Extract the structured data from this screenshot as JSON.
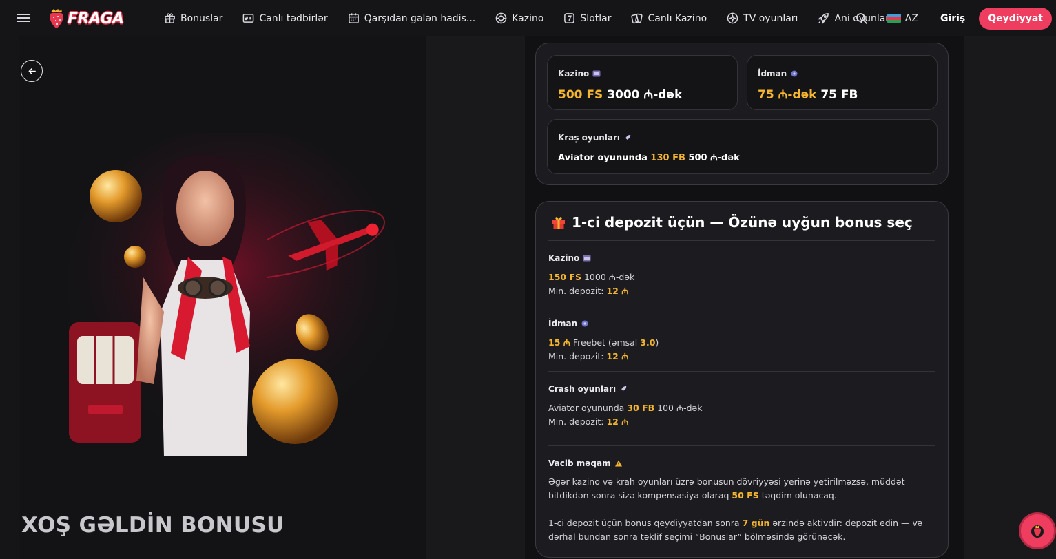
{
  "header": {
    "logo_text": "FRAGA",
    "nav": [
      {
        "label": "Bonuslar",
        "icon": "gift-icon"
      },
      {
        "label": "Canlı tədbirlər",
        "icon": "live-score-icon"
      },
      {
        "label": "Qarşıdan gələn hadis...",
        "icon": "calendar-icon"
      },
      {
        "label": "Kazino",
        "icon": "casino-chip-icon"
      },
      {
        "label": "Slotlar",
        "icon": "slot-seven-icon"
      },
      {
        "label": "Canlı Kazino",
        "icon": "cards-icon"
      },
      {
        "label": "TV oyunları",
        "icon": "tv-games-icon"
      },
      {
        "label": "Ani oyunlar",
        "icon": "rocket-icon"
      }
    ],
    "lang": "AZ",
    "login_label": "Giriş",
    "register_label": "Qeydiyyat"
  },
  "hero": {
    "title": "XOŞ GƏLDİN BONUSU"
  },
  "summary": {
    "kazino": {
      "label": "Kazino",
      "highlight": "500 FS",
      "rest": "3000 ₼-dək"
    },
    "idman": {
      "label": "İdman",
      "highlight": "75 ₼-dək",
      "rest": "75 FB"
    },
    "crash": {
      "label": "Kraş oyunları",
      "pre": "Aviator oyununda",
      "highlight": "130 FB",
      "rest": "500 ₼-dək"
    }
  },
  "deposit": {
    "title": "1-ci depozit üçün — Özünə uyğun bonus seç",
    "sections": {
      "kazino": {
        "label": "Kazino",
        "highlight": "150 FS",
        "rest": "1000 ₼-dək",
        "min_label": "Min. depozit:",
        "min_value": "12 ₼"
      },
      "idman": {
        "label": "İdman",
        "highlight": "15 ₼",
        "rest_a": "Freebet (əmsal",
        "coef": "3.0",
        "rest_b": ")",
        "min_label": "Min. depozit:",
        "min_value": "12 ₼"
      },
      "crash": {
        "label": "Crash oyunları",
        "pre": "Aviator oyununda",
        "highlight": "30 FB",
        "rest": "100 ₼-dək",
        "min_label": "Min. depozit:",
        "min_value": "12 ₼"
      }
    },
    "important": {
      "label": "Vacib məqam",
      "p1_a": "Əgər kazino və krah oyunları üzrə bonusun dövriyyəsi yerinə yetirilməzsə, müddət bitdikdən sonra sizə kompensasiya olaraq",
      "p1_hl": "50 FS",
      "p1_b": "təqdim olunacaq.",
      "p2_a": "1-ci depozit üçün bonus qeydiyyatdan sonra",
      "p2_hl": "7 gün",
      "p2_b": "ərzində aktivdir: depozit edin — və dərhal bundan sonra təklif seçimi “Bonuslar” bölməsində görünəcək."
    }
  },
  "colors": {
    "accent": "#ee3d5e",
    "highlight": "#f5b530",
    "bg": "#151518"
  }
}
